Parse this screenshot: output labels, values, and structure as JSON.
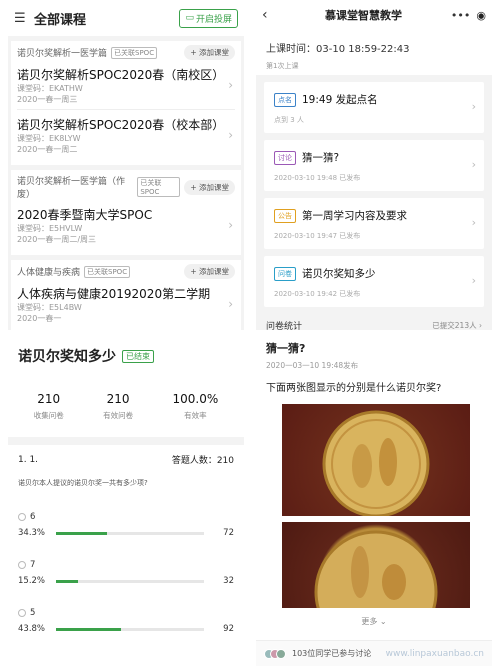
{
  "courses": {
    "menu_icon": "menu-icon",
    "title": "全部课程",
    "live_button": "开启投屏",
    "groups": [
      {
        "name": "诺贝尔奖解析一医学篇",
        "tag": "已关联SPOC",
        "add": "+ 添加课堂",
        "items": [
          {
            "name": "诺贝尔奖解析SPOC2020春（南校区）",
            "code": "课堂码：EKATHW",
            "time": "2020一春一周三"
          },
          {
            "name": "诺贝尔奖解析SPOC2020春（校本部）",
            "code": "课堂码：EK8LYW",
            "time": "2020一春一周二"
          }
        ]
      },
      {
        "name": "诺贝尔奖解析一医学篇（作废）",
        "tag": "已关联SPOC",
        "add": "+ 添加课堂",
        "items": [
          {
            "name": "2020春季暨南大学SPOC",
            "code": "课堂码：E5HVLW",
            "time": "2020一春一周二/周三"
          }
        ]
      },
      {
        "name": "人体健康与疾病",
        "tag": "已关联SPOC",
        "add": "+ 添加课堂",
        "items": [
          {
            "name": "人体疾病与健康20192020第二学期",
            "code": "课堂码：E5L4BW",
            "time": "2020一春一"
          }
        ]
      }
    ]
  },
  "survey": {
    "title": "诺贝尔奖知多少",
    "status": "已结束",
    "stats": [
      {
        "value": "210",
        "label": "收集问卷"
      },
      {
        "value": "210",
        "label": "有效问卷"
      },
      {
        "value": "100.0%",
        "label": "有效率"
      }
    ],
    "question_no": "1. 1.",
    "answer_count": "答题人数：210",
    "question_text": "诺贝尔本人提议的诺贝尔奖一共有多少项?",
    "options": [
      {
        "label": "6",
        "percent": "34.3%",
        "fraction": 0.343,
        "count": "72"
      },
      {
        "label": "7",
        "percent": "15.2%",
        "fraction": 0.152,
        "count": "32"
      },
      {
        "label": "5",
        "percent": "43.8%",
        "fraction": 0.438,
        "count": "92"
      }
    ]
  },
  "classroom": {
    "title": "慕课堂智慧教学",
    "time": "上课时间：03-10 18:59-22:43",
    "sub": "第1次上课",
    "cards": [
      {
        "tag": "点名",
        "title": "19:49 发起点名",
        "meta": "点到 3 人"
      },
      {
        "tag": "讨论",
        "title": "猜一猜?",
        "meta": "2020-03-10 19:48 已发布"
      },
      {
        "tag": "公告",
        "title": "第一周学习内容及要求",
        "meta": "2020-03-10 19:47 已发布"
      },
      {
        "tag": "问卷",
        "title": "诺贝尔奖知多少",
        "meta": "2020-03-10 19:42 已发布"
      }
    ],
    "footer_label": "问卷统计",
    "footer_value": "已提交213人"
  },
  "quiz": {
    "title": "猜一猜?",
    "meta": "2020一03一10 19:48发布",
    "question": "下面两张图显示的分别是什么诺贝尔奖?",
    "more": "更多",
    "participants": "103位同学已参与讨论",
    "watermark": "www.linpaxuanbao.cn"
  }
}
